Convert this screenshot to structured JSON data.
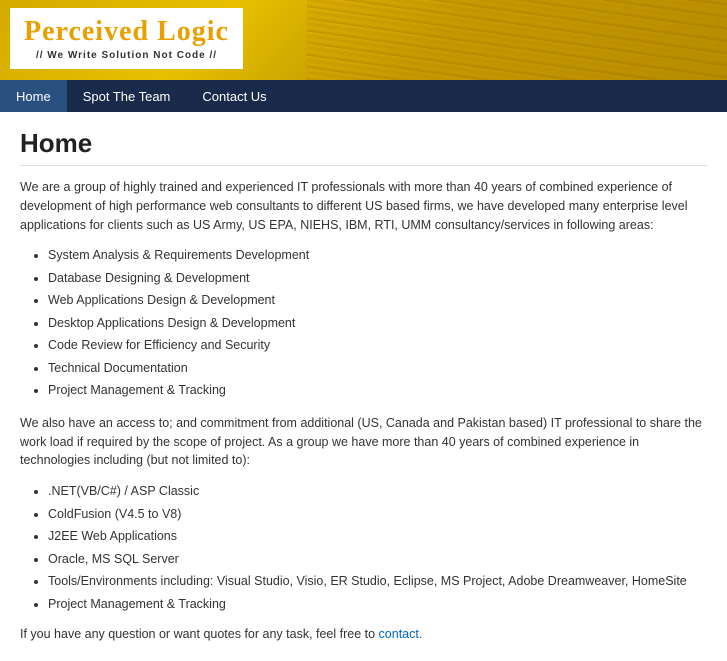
{
  "header": {
    "logo_title": "Perceived Logic",
    "logo_subtitle": "// We Write Solution Not Code //"
  },
  "nav": {
    "items": [
      {
        "label": "Home",
        "active": true
      },
      {
        "label": "Spot The Team",
        "active": false
      },
      {
        "label": "Contact Us",
        "active": false
      }
    ]
  },
  "main": {
    "page_title": "Home",
    "intro_paragraph": "We are a group of highly trained and experienced IT professionals with more than 40 years of combined experience of development of high performance web consultants to different US based firms, we have developed many enterprise level applications for clients such as US Army, US EPA, NIEHS, IBM, RTI, UMM consultancy/services in following areas:",
    "services": [
      "System Analysis & Requirements Development",
      "Database Designing & Development",
      "Web Applications Design & Development",
      "Desktop Applications Design & Development",
      "Code Review for Efficiency and Security",
      "Technical Documentation",
      "Project Management & Tracking"
    ],
    "second_paragraph": "We also have an access to; and commitment from additional (US, Canada and Pakistan based) IT professional to share the work load if required by the scope of project. As a group we have more than 40 years of combined experience in technologies including (but not limited to):",
    "technologies": [
      ".NET(VB/C#) / ASP Classic",
      "ColdFusion (V4.5 to V8)",
      "J2EE Web Applications",
      "Oracle, MS SQL Server",
      "Tools/Environments including: Visual Studio, Visio, ER Studio, Eclipse, MS Project, Adobe Dreamweaver, HomeSite",
      "Project Management & Tracking"
    ],
    "contact_line_prefix": "If you have any question or want quotes for any task, feel free to ",
    "contact_link_text": "contact.",
    "contact_link_href": "#contact"
  }
}
